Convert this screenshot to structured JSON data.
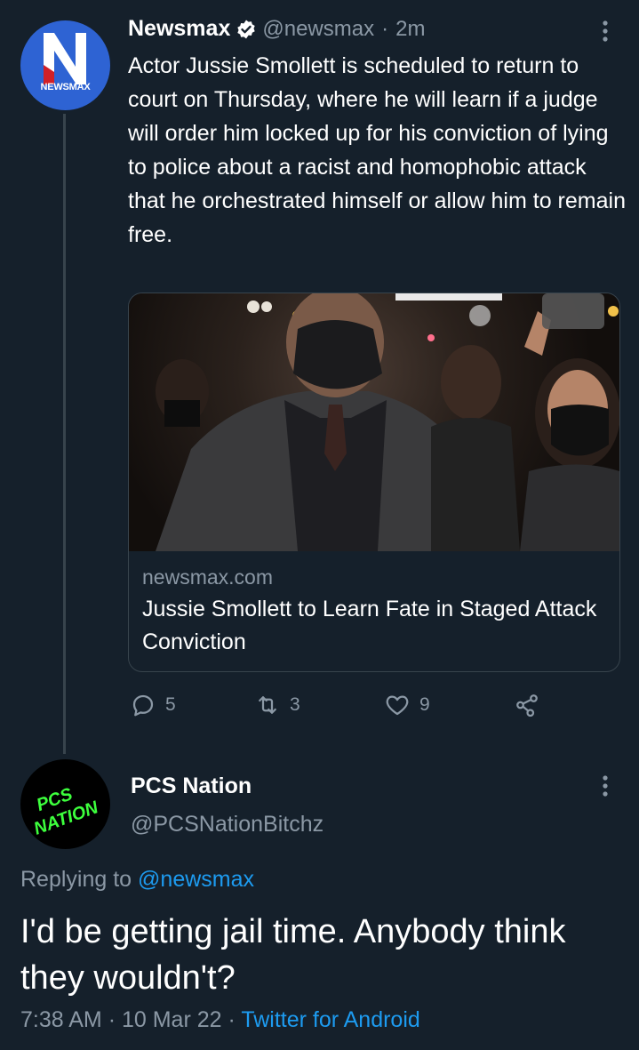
{
  "tweet": {
    "author_name": "Newsmax",
    "author_handle": "@newsmax",
    "separator": "·",
    "time_ago": "2m",
    "avatar_text": "NEWSMAX",
    "text": "Actor Jussie Smollett is scheduled to return to court on Thursday, where he will learn if a judge will order him locked up for his conviction of lying to police about a racist and homophobic attack that he orchestrated himself or allow him to remain free.",
    "card": {
      "domain": "newsmax.com",
      "title": "Jussie Smollett to Learn Fate in Staged Attack Conviction"
    },
    "actions": {
      "replies": "5",
      "retweets": "3",
      "likes": "9"
    }
  },
  "reply": {
    "author_name": "PCS Nation",
    "author_handle": "@PCSNationBitchz",
    "avatar_text": "PCS NATION",
    "replying_prefix": "Replying to",
    "replying_to": "@newsmax",
    "text": "I'd be getting jail time. Anybody think they wouldn't?",
    "time": "7:38 AM",
    "date": "10 Mar 22",
    "sep1": "·",
    "sep2": "·",
    "client": "Twitter for Android"
  },
  "colors": {
    "background": "#15202b",
    "link": "#1d9bf0",
    "secondary_text": "#8b98a5",
    "verified": "#ffffff",
    "newsmax_blue": "#2e63d3",
    "newsmax_red": "#d12027",
    "pcs_green": "#3dff3d"
  }
}
